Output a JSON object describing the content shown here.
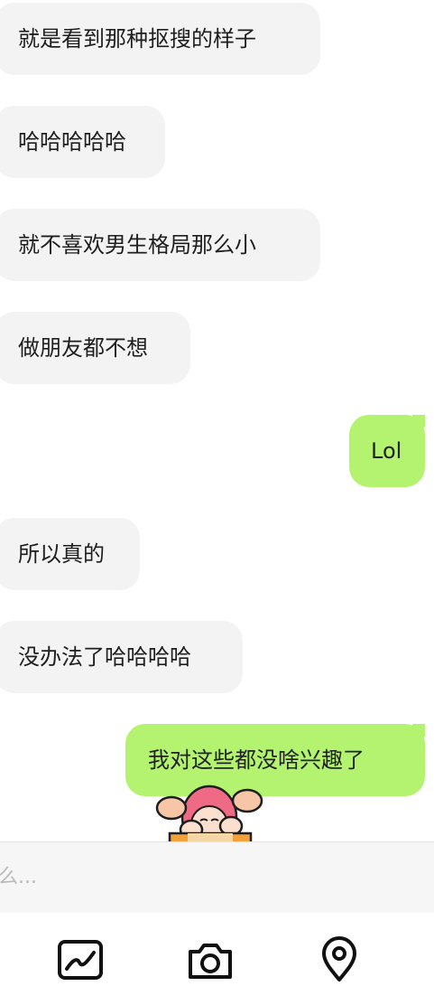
{
  "messages": [
    {
      "side": "in",
      "text": "就是看到那种抠搜的样子"
    },
    {
      "side": "in",
      "text": "哈哈哈哈哈"
    },
    {
      "side": "in",
      "text": "就不喜欢男生格局那么小"
    },
    {
      "side": "in",
      "text": "做朋友都不想"
    },
    {
      "side": "out",
      "text": "Lol"
    },
    {
      "side": "in",
      "text": "所以真的"
    },
    {
      "side": "in",
      "text": "没办法了哈哈哈哈"
    },
    {
      "side": "out",
      "text": "我对这些都没啥兴趣了"
    }
  ],
  "composer": {
    "placeholder": "么..."
  },
  "toolbar": {
    "icons": [
      "gallery-icon",
      "camera-icon",
      "location-icon"
    ]
  },
  "colors": {
    "incoming_bubble": "#f3f3f3",
    "outgoing_bubble": "#b3f36f"
  }
}
